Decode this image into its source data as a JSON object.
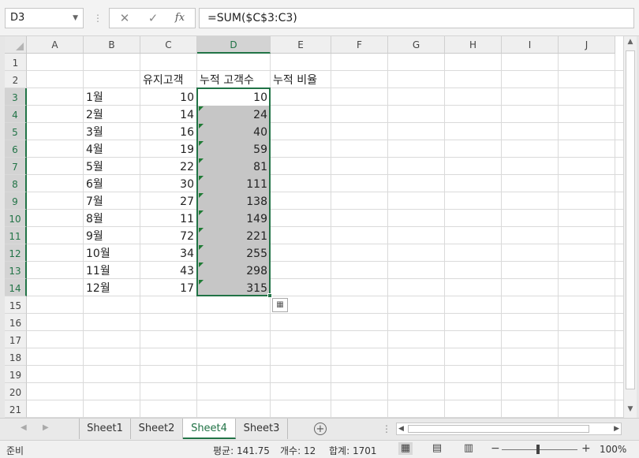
{
  "formula_bar": {
    "name_box": "D3",
    "separator": "⋮",
    "cancel_label": "✕",
    "enter_label": "✓",
    "function_label": "fx",
    "formula": "=SUM($C$3:C3)"
  },
  "columns": [
    "A",
    "B",
    "C",
    "D",
    "E",
    "F",
    "G",
    "H",
    "I",
    "J"
  ],
  "rows": [
    "1",
    "2",
    "3",
    "4",
    "5",
    "6",
    "7",
    "8",
    "9",
    "10",
    "11",
    "12",
    "13",
    "14",
    "15",
    "16",
    "17",
    "18",
    "19",
    "20",
    "21"
  ],
  "headers": {
    "c": "유지고객",
    "d": "누적 고객수",
    "e": "누적 비율"
  },
  "data_rows": [
    {
      "month": "1월",
      "c": "10",
      "d": "10"
    },
    {
      "month": "2월",
      "c": "14",
      "d": "24"
    },
    {
      "month": "3월",
      "c": "16",
      "d": "40"
    },
    {
      "month": "4월",
      "c": "19",
      "d": "59"
    },
    {
      "month": "5월",
      "c": "22",
      "d": "81"
    },
    {
      "month": "6월",
      "c": "30",
      "d": "111"
    },
    {
      "month": "7월",
      "c": "27",
      "d": "138"
    },
    {
      "month": "8월",
      "c": "11",
      "d": "149"
    },
    {
      "month": "9월",
      "c": "72",
      "d": "221"
    },
    {
      "month": "10월",
      "c": "34",
      "d": "255"
    },
    {
      "month": "11월",
      "c": "43",
      "d": "298"
    },
    {
      "month": "12월",
      "c": "17",
      "d": "315"
    }
  ],
  "selection": {
    "active_cell": "D3",
    "column": "D",
    "rows": [
      "3",
      "4",
      "5",
      "6",
      "7",
      "8",
      "9",
      "10",
      "11",
      "12",
      "13",
      "14"
    ]
  },
  "sheet_tabs": [
    {
      "label": "Sheet1",
      "active": false
    },
    {
      "label": "Sheet2",
      "active": false
    },
    {
      "label": "Sheet4",
      "active": true
    },
    {
      "label": "Sheet3",
      "active": false
    }
  ],
  "tab_nav": {
    "prev": "◀",
    "next": "▶",
    "add": "+",
    "more": "⋮"
  },
  "status_bar": {
    "ready": "준비",
    "average": "평균: 141.75",
    "count": "개수: 12",
    "sum": "합계: 1701",
    "zoom_minus": "−",
    "zoom_plus": "+",
    "zoom": "100%"
  },
  "icons": {
    "quick_analysis": "quick-analysis-icon",
    "normal_view": "normal-view-icon",
    "page_layout": "page-layout-icon",
    "page_break": "page-break-icon"
  },
  "colors": {
    "accent": "#217346",
    "selection_fill": "#c6c6c6",
    "error_triangle": "#1e7b34"
  }
}
